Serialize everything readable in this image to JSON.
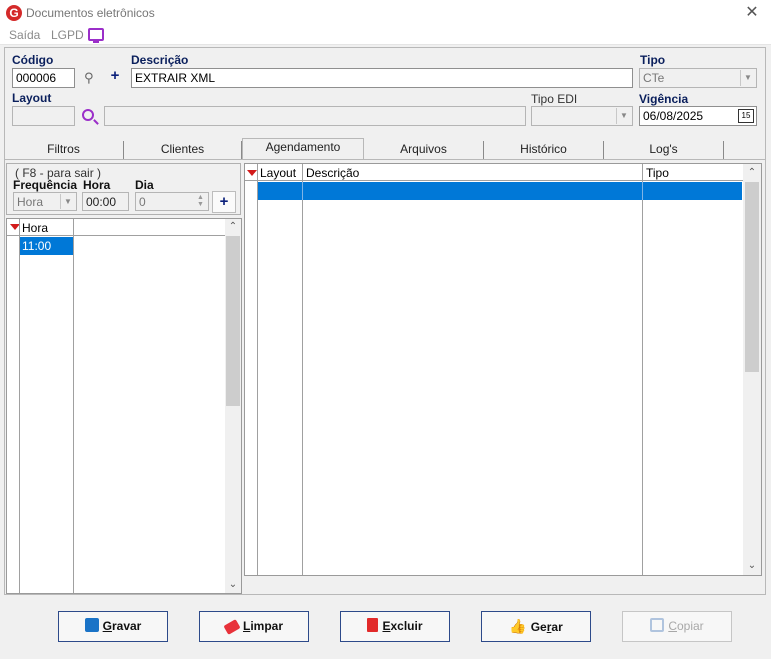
{
  "window": {
    "title": "Documentos eletrônicos",
    "logo_letter": "G"
  },
  "menu": {
    "items": [
      "Saída",
      "LGPD"
    ]
  },
  "form": {
    "codigo_label": "Código",
    "codigo_value": "000006",
    "descricao_label": "Descrição",
    "descricao_value": "EXTRAIR XML",
    "tipo_label": "Tipo",
    "tipo_value": "CTe",
    "layout_label": "Layout",
    "layout_value": "",
    "layout_desc_value": "",
    "tipo_edi_label": "Tipo EDI",
    "tipo_edi_value": "",
    "vigencia_label": "Vigência",
    "vigencia_value": "06/08/2025",
    "calendar_day": "15"
  },
  "tabs": [
    "Filtros",
    "Clientes",
    "Agendamento",
    "Arquivos",
    "Histórico",
    "Log's"
  ],
  "schedule": {
    "hint": "( F8 - para sair )",
    "frequencia_label": "Frequência",
    "frequencia_value": "Hora",
    "hora_label": "Hora",
    "hora_value": "00:00",
    "dia_label": "Dia",
    "dia_value": "0",
    "list_header": "Hora",
    "list_rows": [
      "11:00"
    ]
  },
  "files_grid": {
    "columns": [
      "Layout",
      "Descrição",
      "Tipo"
    ]
  },
  "buttons": {
    "gravar": {
      "accel": "G",
      "rest": "ravar"
    },
    "limpar": {
      "accel": "L",
      "rest": "impar"
    },
    "excluir": {
      "accel": "E",
      "rest": "xcluir"
    },
    "gerar": {
      "pre": "Ge",
      "accel": "r",
      "rest": "ar"
    },
    "copiar": {
      "accel": "C",
      "rest": "opiar"
    }
  },
  "colors": {
    "accent": "#0078d7",
    "label": "#0a1f5c",
    "brand_red": "#d42a2a",
    "icon_purple": "#9b2fc9"
  }
}
